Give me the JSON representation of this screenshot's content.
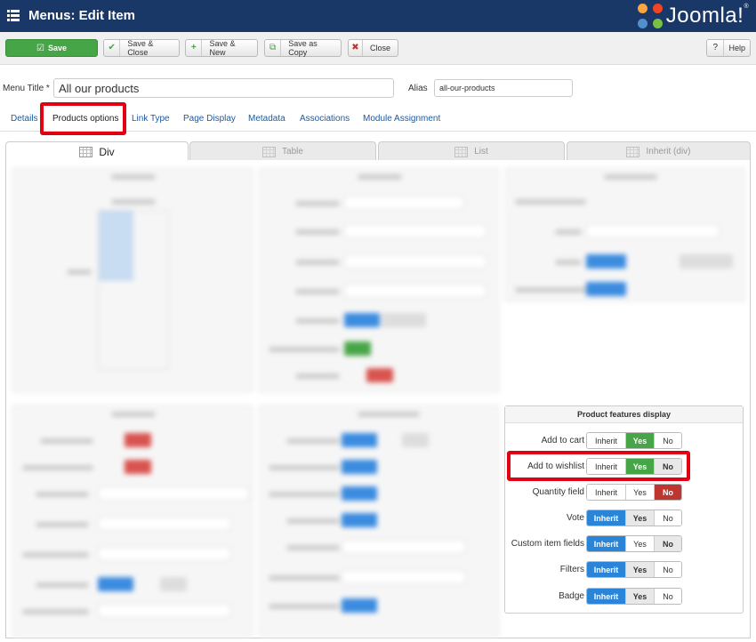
{
  "header": {
    "title": "Menus: Edit Item",
    "logo_text": "Joomla!",
    "logo_reg": "®"
  },
  "toolbar": {
    "save": "Save",
    "save_close": "Save & Close",
    "save_new": "Save & New",
    "save_copy": "Save as Copy",
    "close": "Close",
    "help": "Help"
  },
  "form": {
    "menu_title_label": "Menu Title *",
    "menu_title_value": "All our products",
    "alias_label": "Alias",
    "alias_value": "all-our-products"
  },
  "tabs": [
    "Details",
    "Products options",
    "Link Type",
    "Page Display",
    "Metadata",
    "Associations",
    "Module Assignment"
  ],
  "layout_tabs": [
    "Div",
    "Table",
    "List",
    "Inherit (div)"
  ],
  "product_features": {
    "title": "Product features display",
    "rows": [
      {
        "label": "Add to cart",
        "options": [
          "Inherit",
          "Yes",
          "No"
        ],
        "selected": "Yes"
      },
      {
        "label": "Add to wishlist",
        "options": [
          "Inherit",
          "Yes",
          "No"
        ],
        "selected": "Yes"
      },
      {
        "label": "Quantity field",
        "options": [
          "Inherit",
          "Yes",
          "No"
        ],
        "selected": "No"
      },
      {
        "label": "Vote",
        "options": [
          "Inherit",
          "Yes",
          "No"
        ],
        "selected": "Inherit"
      },
      {
        "label": "Custom item fields",
        "options": [
          "Inherit",
          "Yes",
          "No"
        ],
        "selected": "Inherit"
      },
      {
        "label": "Filters",
        "options": [
          "Inherit",
          "Yes",
          "No"
        ],
        "selected": "Inherit"
      },
      {
        "label": "Badge",
        "options": [
          "Inherit",
          "Yes",
          "No"
        ],
        "selected": "Inherit"
      }
    ]
  },
  "colors": {
    "header_bg": "#1a3867",
    "save_green": "#46a546",
    "highlight_red": "#e00012",
    "inherit_blue": "#2a84d8",
    "no_red": "#bd362f"
  }
}
